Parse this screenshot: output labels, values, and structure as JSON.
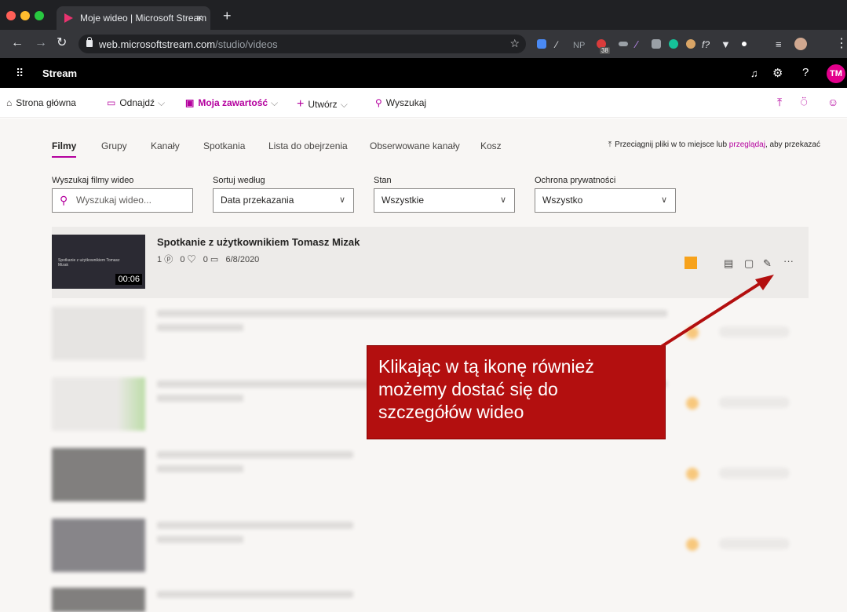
{
  "browser": {
    "tab_title": "Moje wideo | Microsoft Stream",
    "tab_close": "×",
    "new_tab": "+",
    "url_host": "web.microsoftstream.com",
    "url_path": "/studio/videos",
    "ext_badge": "38",
    "ext_np": "NP"
  },
  "stream": {
    "brand": "Stream",
    "avatar_initials": "TM"
  },
  "nav": {
    "home": "Strona główna",
    "discover": "Odnajdź",
    "my_content": "Moja zawartość",
    "create": "Utwórz",
    "search": "Wyszukaj"
  },
  "pivots": [
    "Filmy",
    "Grupy",
    "Kanały",
    "Spotkania",
    "Lista do obejrzenia",
    "Obserwowane kanały",
    "Kosz"
  ],
  "upload_hint": {
    "before": "Przeciągnij pliki w to miejsce lub ",
    "link": "przeglądaj",
    "after": ", aby przekazać"
  },
  "filters": {
    "search_label": "Wyszukaj filmy wideo",
    "search_placeholder": "Wyszukaj wideo...",
    "sort_label": "Sortuj według",
    "sort_value": "Data przekazania",
    "status_label": "Stan",
    "status_value": "Wszystkie",
    "privacy_label": "Ochrona prywatności",
    "privacy_value": "Wszystko"
  },
  "video": {
    "title": "Spotkanie z użytkownikiem Tomasz Mizak",
    "thumb_title": "Spotkanie z użytkownikiem Tomasz Mizak",
    "duration": "00:06",
    "views": "1",
    "likes": "0",
    "comments": "0",
    "date": "6/8/2020",
    "more": "···"
  },
  "callout": {
    "text": "Klikając w tą ikonę również możemy dostać się do szczegółów wideo"
  },
  "colors": {
    "accent": "#b4009e",
    "callout": "#b30f0f",
    "badge": "#f7a21b"
  }
}
